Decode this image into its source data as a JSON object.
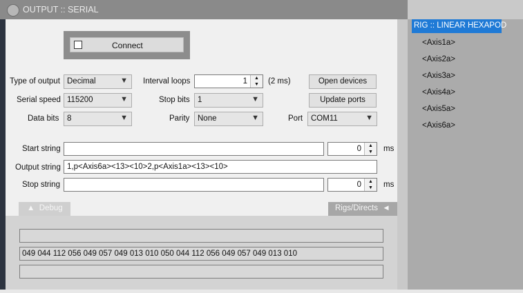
{
  "window": {
    "title": "OUTPUT :: SERIAL"
  },
  "connect": {
    "label": "Connect",
    "checked": false
  },
  "settings": {
    "type_of_output": {
      "label": "Type of output",
      "value": "Decimal"
    },
    "serial_speed": {
      "label": "Serial speed",
      "value": "115200"
    },
    "data_bits": {
      "label": "Data bits",
      "value": "8"
    },
    "interval_loops": {
      "label": "Interval loops",
      "value": "1",
      "unit": "(2 ms)"
    },
    "stop_bits": {
      "label": "Stop bits",
      "value": "1"
    },
    "parity": {
      "label": "Parity",
      "value": "None"
    },
    "port": {
      "label": "Port",
      "value": "COM11"
    }
  },
  "buttons": {
    "open_devices": "Open devices",
    "update_ports": "Update ports"
  },
  "strings": {
    "start": {
      "label": "Start string",
      "value": "",
      "delay": "0",
      "unit": "ms"
    },
    "output": {
      "label": "Output string",
      "value": "1,p<Axis6a><13><10>2,p<Axis1a><13><10>"
    },
    "stop": {
      "label": "Stop string",
      "value": "",
      "delay": "0",
      "unit": "ms"
    }
  },
  "tabs": {
    "debug": "Debug",
    "rigs": "Rigs/Directs"
  },
  "debug": {
    "line1": "",
    "line2": "049 044 112 056 049 057 049 013 010 050 044 112 056 049 057 049 013 010",
    "line3": ""
  },
  "rig": {
    "header": "RIG :: LINEAR HEXAPOD",
    "axes": [
      "<Axis1a>",
      "<Axis2a>",
      "<Axis3a>",
      "<Axis4a>",
      "<Axis5a>",
      "<Axis6a>"
    ]
  },
  "icons": {
    "dropdown": "▼",
    "spin_up": "▲",
    "spin_down": "▼",
    "debug_tab": "▲",
    "rigs_tab": "◄"
  },
  "colors": {
    "accent": "#1f7ad6",
    "titlebar": "#8a8a8a",
    "dialog": "#f0f0f0"
  }
}
